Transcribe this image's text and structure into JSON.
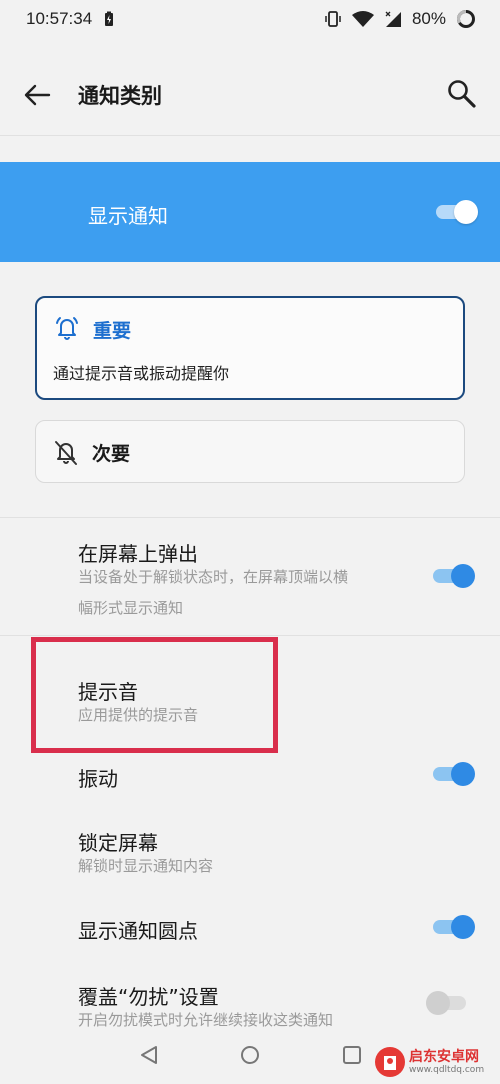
{
  "status_bar": {
    "time": "10:57:34",
    "battery": "80%"
  },
  "header": {
    "title": "通知类别"
  },
  "master": {
    "label": "显示通知",
    "enabled": true
  },
  "importance": {
    "important": {
      "name": "重要",
      "description": "通过提示音或振动提醒你",
      "selected": true
    },
    "secondary": {
      "name": "次要",
      "selected": false
    }
  },
  "settings": {
    "popup": {
      "title": "在屏幕上弹出",
      "subtitle_line1": "当设备处于解锁状态时，在屏幕顶端以横",
      "subtitle_line2": "幅形式显示通知",
      "enabled": true
    },
    "sound": {
      "title": "提示音",
      "subtitle": "应用提供的提示音"
    },
    "vibrate": {
      "title": "振动",
      "enabled": true
    },
    "lockscreen": {
      "title": "锁定屏幕",
      "subtitle": "解锁时显示通知内容"
    },
    "dot": {
      "title": "显示通知圆点",
      "enabled": true
    },
    "dnd": {
      "title": "覆盖“勿扰”设置",
      "subtitle": "开启勿扰模式时允许继续接收这类通知",
      "enabled": false
    }
  },
  "watermark": {
    "name": "启东安卓网",
    "url": "www.qdltdq.com"
  },
  "colors": {
    "accent": "#3d9ef0",
    "highlight": "#d92e4c"
  }
}
